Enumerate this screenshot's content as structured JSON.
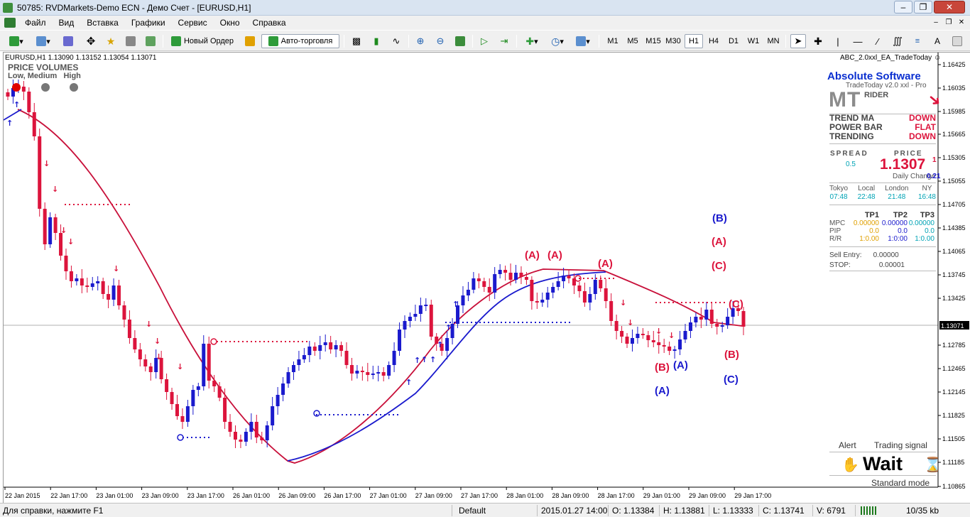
{
  "window": {
    "title": "50785: RVDMarkets-Demo ECN - Демо Счет - [EURUSD,H1]"
  },
  "menu": [
    "Файл",
    "Вид",
    "Вставка",
    "Графики",
    "Сервис",
    "Окно",
    "Справка"
  ],
  "toolbar": {
    "new_order": "Новый Ордер",
    "auto_trading": "Авто-торговля",
    "timeframes": [
      "M1",
      "M5",
      "M15",
      "M30",
      "H1",
      "H4",
      "D1",
      "W1",
      "MN"
    ],
    "selected_timeframe": "H1"
  },
  "chart": {
    "header": "EURUSD,H1  1.13090 1.13152 1.13054 1.13071",
    "indicator_title": "PRICE VOLUMES",
    "vol_levels": [
      "Low",
      "Medium",
      "High"
    ],
    "ea_name": "ABC_2.0xxl_EA_TradeToday",
    "current_price_label": "1.13071",
    "price_ticks": [
      "1.16425",
      "1.16035",
      "1.15985",
      "1.15665",
      "1.15305",
      "1.15055",
      "1.14705",
      "1.14385",
      "1.14065",
      "1.13745",
      "1.13425",
      "1.13071",
      "1.12785",
      "1.12465",
      "1.12145",
      "1.11825",
      "1.11505",
      "1.11185",
      "1.10865"
    ],
    "time_ticks": [
      "22 Jan 2015",
      "22 Jan 17:00",
      "23 Jan 01:00",
      "23 Jan 09:00",
      "23 Jan 17:00",
      "26 Jan 01:00",
      "26 Jan 09:00",
      "26 Jan 17:00",
      "27 Jan 01:00",
      "27 Jan 09:00",
      "27 Jan 17:00",
      "28 Jan 01:00",
      "28 Jan 09:00",
      "28 Jan 17:00",
      "29 Jan 01:00",
      "29 Jan 09:00",
      "29 Jan 17:00"
    ],
    "wave_labels": [
      {
        "text": "(A)",
        "color": "#dc143c"
      },
      {
        "text": "(A)",
        "color": "#dc143c"
      },
      {
        "text": "(A)",
        "color": "#dc143c"
      },
      {
        "text": "(B)",
        "color": "#1a1acd"
      },
      {
        "text": "(A)",
        "color": "#dc143c"
      },
      {
        "text": "(C)",
        "color": "#dc143c"
      },
      {
        "text": "(C)",
        "color": "#dc143c"
      },
      {
        "text": "(B)",
        "color": "#dc143c"
      },
      {
        "text": "(B)",
        "color": "#dc143c"
      },
      {
        "text": "(A)",
        "color": "#1a1acd"
      },
      {
        "text": "(A)",
        "color": "#1a1acd"
      },
      {
        "text": "(C)",
        "color": "#1a1acd"
      }
    ]
  },
  "panel": {
    "brand": "Absolute Software",
    "version": "TradeToday v2.0 xxl - Pro",
    "mt": "MT",
    "rider": "RIDER",
    "rows": [
      {
        "label": "TREND MA",
        "value": "DOWN"
      },
      {
        "label": "POWER BAR",
        "value": "FLAT"
      },
      {
        "label": "TRENDING",
        "value": "DOWN"
      }
    ],
    "spread_label": "SPREAD",
    "spread_value": "0.5",
    "price_label": "PRICE",
    "price_value": "1.1307",
    "price_sup": "1",
    "daily_change_label": "Daily Change",
    "daily_change_value": "0.21",
    "sessions": [
      {
        "city": "Tokyo",
        "time": "07:48"
      },
      {
        "city": "Local",
        "time": "22:48"
      },
      {
        "city": "London",
        "time": "21:48"
      },
      {
        "city": "NY",
        "time": "16:48"
      }
    ],
    "tp_headers": [
      "TP1",
      "TP2",
      "TP3"
    ],
    "tp_rows": [
      {
        "label": "MPC",
        "values": [
          "0.00000",
          "0.00000",
          "0.00000"
        ]
      },
      {
        "label": "PIP",
        "values": [
          "0.0",
          "0.0",
          "0.0"
        ]
      },
      {
        "label": "R/R",
        "values": [
          "1:0.00",
          "1:0:00",
          "1:0.00"
        ]
      }
    ],
    "sell_entry_label": "Sell Entry:",
    "sell_entry_value": "0.00000",
    "stop_label": "STOP:",
    "stop_value": "0.00001",
    "alert_label": "Alert",
    "trading_signal_label": "Trading  signal",
    "signal": "Wait",
    "mode": "Standard mode"
  },
  "status": {
    "help": "Для справки, нажмите F1",
    "profile": "Default",
    "datetime": "2015.01.27 14:00",
    "open": "O: 1.13384",
    "high": "H: 1.13881",
    "low": "L: 1.13333",
    "close": "C: 1.13741",
    "volume": "V: 6791",
    "traffic": "10/35 kb"
  },
  "colors": {
    "bull": "#1a1acd",
    "bear": "#dc143c",
    "ma_red": "#c8103a",
    "ma_blue": "#1a1acd",
    "mint": "#00a3b5",
    "orange": "#e0a000"
  }
}
